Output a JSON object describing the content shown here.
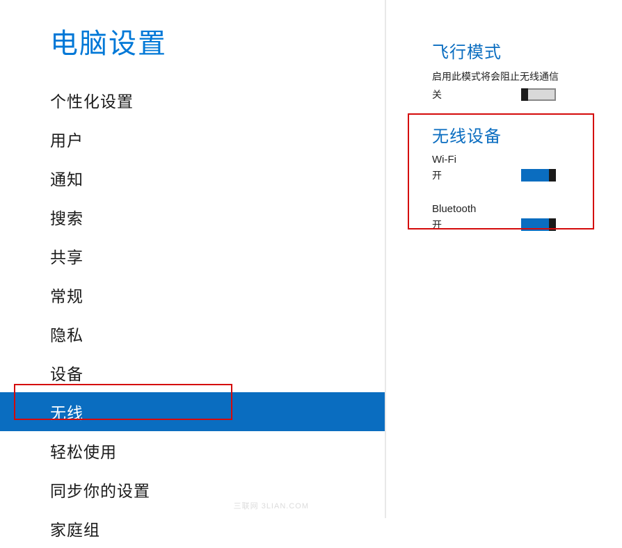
{
  "sidebar": {
    "title": "电脑设置",
    "items": [
      {
        "label": "个性化设置",
        "selected": false
      },
      {
        "label": "用户",
        "selected": false
      },
      {
        "label": "通知",
        "selected": false
      },
      {
        "label": "搜索",
        "selected": false
      },
      {
        "label": "共享",
        "selected": false
      },
      {
        "label": "常规",
        "selected": false
      },
      {
        "label": "隐私",
        "selected": false
      },
      {
        "label": "设备",
        "selected": false
      },
      {
        "label": "无线",
        "selected": true
      },
      {
        "label": "轻松使用",
        "selected": false
      },
      {
        "label": "同步你的设置",
        "selected": false
      },
      {
        "label": "家庭组",
        "selected": false
      }
    ]
  },
  "content": {
    "airplane": {
      "title": "飞行模式",
      "desc": "启用此模式将会阻止无线通信",
      "state": "关",
      "on": false
    },
    "wireless": {
      "title": "无线设备",
      "devices": [
        {
          "name": "Wi-Fi",
          "state": "开",
          "on": true
        },
        {
          "name": "Bluetooth",
          "state": "开",
          "on": true
        }
      ]
    }
  },
  "watermark": "三联网 3LIAN.COM"
}
